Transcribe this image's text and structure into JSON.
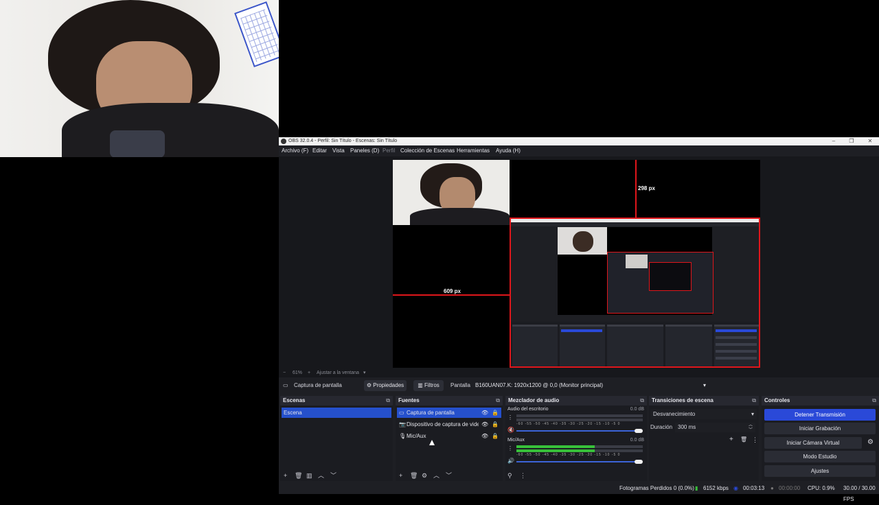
{
  "window": {
    "title": "OBS 32.0.4 - Perfil: Sin Título - Escenas: Sin Título"
  },
  "menu": [
    "Archivo (F)",
    "Editar",
    "Vista",
    "Paneles (D)",
    "Perfil",
    "Colección de Escenas",
    "Herramientas",
    "Ayuda (H)"
  ],
  "preview": {
    "measure_top": "298 px",
    "measure_left": "609 px",
    "zoom_minus": "−",
    "zoom_value": "61%",
    "zoom_plus": "+",
    "zoom_fit": "Ajustar a la ventana"
  },
  "source_bar": {
    "source_name": "Captura de pantalla",
    "properties": "Propiedades",
    "filters": "Filtros",
    "display_label": "Pantalla",
    "display_value": "B160UAN07.K: 1920x1200 @ 0,0 (Monitor principal)"
  },
  "scenes": {
    "title": "Escenas",
    "items": [
      "Escena"
    ]
  },
  "sources": {
    "title": "Fuentes",
    "items": [
      "Captura de pantalla",
      "Dispositivo de captura de vide",
      "Mic/Aux"
    ]
  },
  "mixer": {
    "title": "Mezclador de audio",
    "channels": [
      {
        "name": "Audio del escritorio",
        "db": "0.0 dB",
        "level": 0,
        "muted": true
      },
      {
        "name": "Mic/Aux",
        "db": "0.0 dB",
        "level": 0.62,
        "muted": false
      }
    ],
    "scale": "-60 -55 -50 -45 -40 -35 -30 -25 -20 -15 -10 -5 0"
  },
  "transitions": {
    "title": "Transiciones de escena",
    "selected": "Desvanecimiento",
    "duration_label": "Duración",
    "duration_value": "300 ms"
  },
  "controls": {
    "title": "Controles",
    "buttons": [
      "Detener Transmisión",
      "Iniciar Grabación",
      "Iniciar Cámara Virtual",
      "Modo Estudio",
      "Ajustes"
    ]
  },
  "status": {
    "dropped": "Fotogramas Perdidos 0 (0.0%)",
    "bitrate": "6152 kbps",
    "stream_time": "00:03:13",
    "rec_time": "00:00:00",
    "cpu": "CPU: 0.9%",
    "fps": "30.00 / 30.00 FPS"
  },
  "colors": {
    "accent": "#2a49d8",
    "panel": "#1e1f24",
    "guide": "#e0161b"
  }
}
